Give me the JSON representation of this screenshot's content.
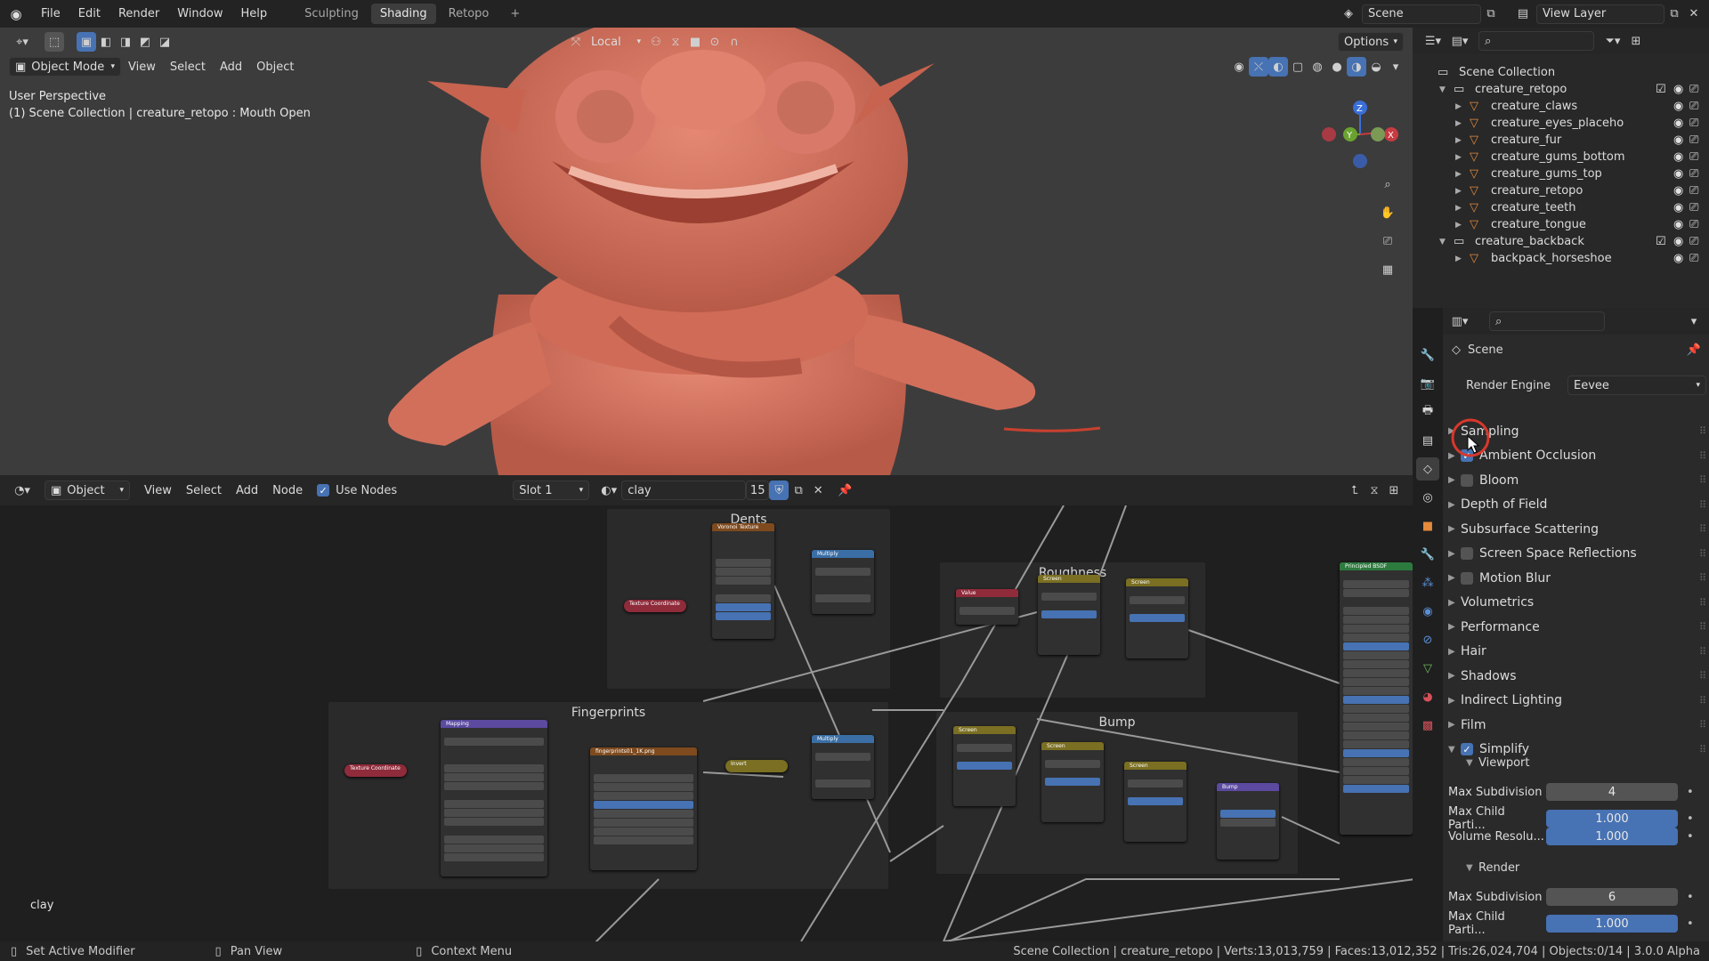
{
  "topbar": {
    "menus": [
      "File",
      "Edit",
      "Render",
      "Window",
      "Help"
    ],
    "workspaces": [
      "Sculpting",
      "Shading",
      "Retopo"
    ],
    "active_workspace": "Shading",
    "add_tab": "+",
    "scene": "Scene",
    "view_layer": "View Layer"
  },
  "viewport": {
    "mode": "Object Mode",
    "menus": [
      "View",
      "Select",
      "Add",
      "Object"
    ],
    "transform_orientation": "Local",
    "options": "Options",
    "perspective_label": "User Perspective",
    "context_label": "(1) Scene Collection | creature_retopo : Mouth Open",
    "gizmo": {
      "z": "Z",
      "y": "Y",
      "x": "X"
    }
  },
  "node_editor": {
    "editor_type": "Object",
    "menus": [
      "View",
      "Select",
      "Add",
      "Node"
    ],
    "use_nodes": "Use Nodes",
    "slot": "Slot 1",
    "material": "clay",
    "users": "15",
    "frames": {
      "dents": "Dents",
      "roughness": "Roughness",
      "fingerprints": "Fingerprints",
      "bump": "Bump"
    },
    "material_label": "clay",
    "nodes": {
      "voronoi": "Voronoi Texture",
      "texcoord1": "Texture Coordinate",
      "multiply1": "Multiply",
      "value": "Value",
      "screen1": "Screen",
      "screen2": "Screen",
      "bsdf": "Principled BSDF",
      "texcoord2": "Texture Coordinate",
      "mapping": "Mapping",
      "image": "fingerprints01_1K.png",
      "invert": "Invert",
      "multiply2": "Multiply",
      "screen3": "Screen",
      "screen4": "Screen",
      "screen5": "Screen",
      "bump": "Bump"
    }
  },
  "outliner": {
    "search_placeholder": "",
    "rows": [
      {
        "label": "Scene Collection",
        "type": "collection"
      },
      {
        "label": "creature_retopo",
        "type": "collection"
      },
      {
        "label": "creature_claws",
        "type": "mesh"
      },
      {
        "label": "creature_eyes_placeho",
        "type": "mesh"
      },
      {
        "label": "creature_fur",
        "type": "mesh"
      },
      {
        "label": "creature_gums_bottom",
        "type": "mesh"
      },
      {
        "label": "creature_gums_top",
        "type": "mesh"
      },
      {
        "label": "creature_retopo",
        "type": "mesh"
      },
      {
        "label": "creature_teeth",
        "type": "mesh"
      },
      {
        "label": "creature_tongue",
        "type": "mesh"
      },
      {
        "label": "creature_backback",
        "type": "collection"
      },
      {
        "label": "backpack_horseshoe",
        "type": "mesh"
      }
    ]
  },
  "properties": {
    "context": "Scene",
    "render_engine_label": "Render Engine",
    "render_engine": "Eevee",
    "panels": [
      {
        "label": "Sampling",
        "checkbox": null
      },
      {
        "label": "Ambient Occlusion",
        "checkbox": true
      },
      {
        "label": "Bloom",
        "checkbox": false
      },
      {
        "label": "Depth of Field",
        "checkbox": null
      },
      {
        "label": "Subsurface Scattering",
        "checkbox": null
      },
      {
        "label": "Screen Space Reflections",
        "checkbox": false
      },
      {
        "label": "Motion Blur",
        "checkbox": false
      },
      {
        "label": "Volumetrics",
        "checkbox": null
      },
      {
        "label": "Performance",
        "checkbox": null
      },
      {
        "label": "Hair",
        "checkbox": null
      },
      {
        "label": "Shadows",
        "checkbox": null
      },
      {
        "label": "Indirect Lighting",
        "checkbox": null
      },
      {
        "label": "Film",
        "checkbox": null
      },
      {
        "label": "Simplify",
        "checkbox": true
      }
    ],
    "viewport_sub": "Viewport",
    "render_sub": "Render",
    "viewport_fields": [
      {
        "label": "Max Subdivision",
        "value": "4"
      },
      {
        "label": "Max Child Parti...",
        "value": "1.000"
      },
      {
        "label": "Volume Resolu...",
        "value": "1.000"
      }
    ],
    "render_fields": [
      {
        "label": "Max Subdivision",
        "value": "6"
      },
      {
        "label": "Max Child Parti...",
        "value": "1.000"
      }
    ]
  },
  "statusbar": {
    "left1": "Set Active Modifier",
    "left2": "Pan View",
    "left3": "Context Menu",
    "right": "Scene Collection | creature_retopo | Verts:13,013,759 | Faces:13,012,352 | Tris:26,024,704 | Objects:0/14 | 3.0.0 Alpha"
  }
}
